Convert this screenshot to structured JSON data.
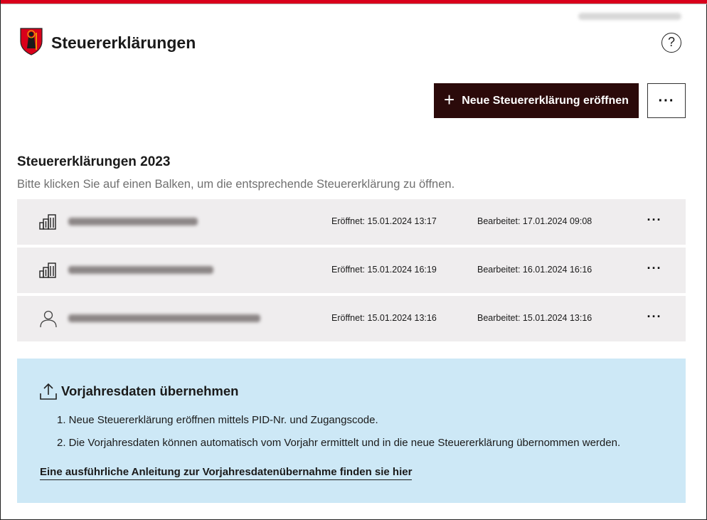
{
  "header": {
    "title": "Steuererklärungen",
    "help_icon": "question-circle-icon",
    "help_label": "?"
  },
  "actions": {
    "new_label": "Neue Steuererklärung eröffnen",
    "new_icon": "plus-icon",
    "more_label": "···"
  },
  "section": {
    "title": "Steuererklärungen 2023",
    "hint": "Bitte klicken Sie auf einen Balken, um die entsprechende Steuererklärung zu öffnen."
  },
  "rows": [
    {
      "icon": "building-icon",
      "opened": "Eröffnet: 15.01.2024 13:17",
      "edited": "Bearbeitet: 17.01.2024 09:08",
      "more": "···"
    },
    {
      "icon": "building-icon",
      "opened": "Eröffnet: 15.01.2024 16:19",
      "edited": "Bearbeitet: 16.01.2024 16:16",
      "more": "···"
    },
    {
      "icon": "person-icon",
      "opened": "Eröffnet: 15.01.2024 13:16",
      "edited": "Bearbeitet: 15.01.2024 13:16",
      "more": "···"
    }
  ],
  "info": {
    "icon": "upload-icon",
    "title": "Vorjahresdaten übernehmen",
    "steps": [
      "1. Neue Steuererklärung eröffnen mittels PID-Nr. und Zugangscode.",
      "2. Die Vorjahresdaten können automatisch vom Vorjahr ermittelt und in die neue Steuererklärung übernommen werden."
    ],
    "link": "Eine ausführliche Anleitung zur Vorjahresdatenübernahme finden sie hier"
  },
  "colors": {
    "brand_red": "#d9001b",
    "primary_button": "#2b0a0a",
    "row_background": "#efedee",
    "info_background": "#cde8f6"
  }
}
